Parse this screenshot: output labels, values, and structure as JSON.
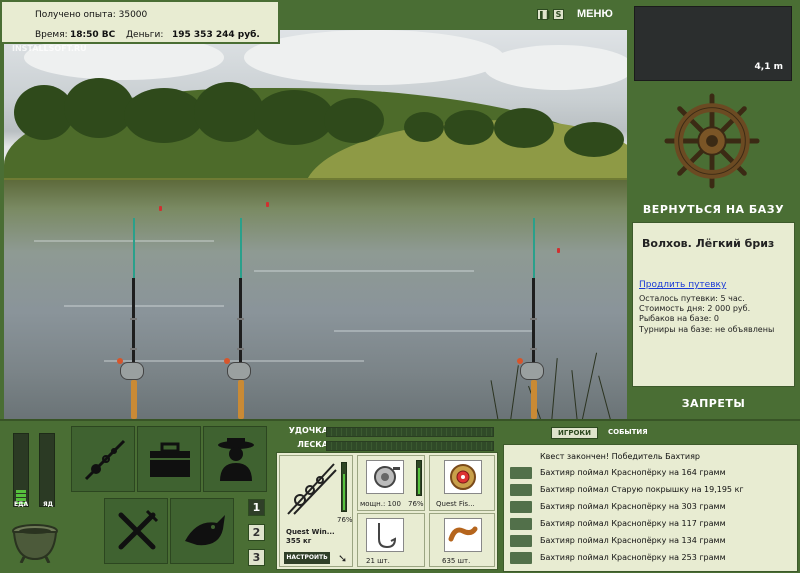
{
  "info": {
    "experience_label": "Получено опыта:",
    "experience_value": "35000",
    "time_label": "Время:",
    "time_value": "18:50 ВС",
    "money_label": "Деньги:",
    "money_value": "195 353 244 руб."
  },
  "watermark": "INSTALLSOFT.RU",
  "top_bar": {
    "pause_icon": "pause-icon",
    "sound_icon": "sound-icon",
    "menu_label": "МЕНЮ"
  },
  "depth": {
    "value": "4,1 m"
  },
  "right_panel": {
    "return_label": "ВЕРНУТЬСЯ НА БАЗУ",
    "location_title": "Волхов. Лёгкий бриз",
    "extend_link": "Продлить путевку",
    "stats": [
      "Осталось путевки: 5 час.",
      "Стоимость дня: 2 000 руб.",
      "Рыбаков на базе: 0",
      "Турниры на базе: не объявлены"
    ],
    "bans_label": "ЗАПРЕТЫ"
  },
  "needs": {
    "food_label": "ЕДА",
    "food_level": 0.2,
    "poison_label": "ЯД",
    "poison_level": 0.0
  },
  "action_tiles": [
    "rods-icon",
    "tackle-box-icon",
    "fisherman-icon",
    "cook-icon",
    "fish-icon"
  ],
  "rod_slots": [
    "1",
    "2",
    "3"
  ],
  "active_rod_slot": "1",
  "tackle": {
    "rod_label": "УДОЧКА",
    "line_label": "ЛЕСКА"
  },
  "inventory": {
    "rod_name": "Quest Win...",
    "rod_weight": "355 кг",
    "rod_percent": "76%",
    "rod_level": 0.76,
    "setup_label": "НАСТРОИТЬ",
    "reel_text": "мощн.: 100",
    "reel_percent": "76%",
    "reel_level": 0.76,
    "line_name": "Quest Fis...",
    "hook_count": "21 шт.",
    "bait_count": "635 шт."
  },
  "events": {
    "tab_players": "ИГРОКИ",
    "tab_events": "СОБЫТИЯ",
    "quest_text": "Квест закончен! Победитель Бахтияр",
    "rows": [
      "Бахтияр поймал Краснопёрку на 164 грамм",
      "Бахтияр поймал Старую покрышку на 19,195 кг",
      "Бахтияр поймал Краснопёрку на 303 грамм",
      "Бахтияр поймал Краснопёрку на 117 грамм",
      "Бахтияр поймал Краснопёрку на 134 грамм",
      "Бахтияр поймал Краснопёрку на 253 грамм"
    ]
  },
  "colors": {
    "frame_green": "#4a6e34",
    "panel_cream": "#e8ecd2",
    "meter_green": "#56c23d"
  }
}
